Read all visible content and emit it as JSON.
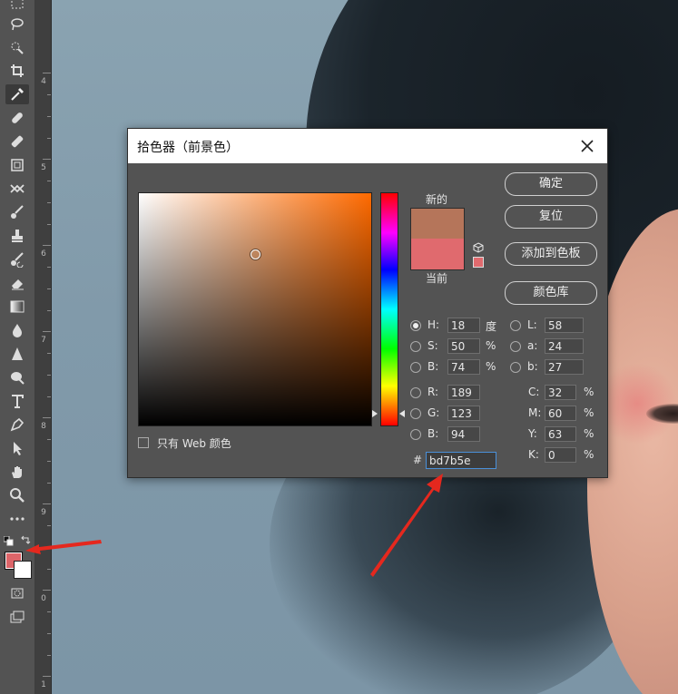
{
  "dialog": {
    "title": "拾色器（前景色）",
    "label_new": "新的",
    "label_current": "当前",
    "buttons": {
      "ok": "确定",
      "reset": "复位",
      "add_to_swatches": "添加到色板",
      "color_libraries": "颜色库"
    },
    "only_web_colors": "只有 Web 颜色",
    "hsb": {
      "h_label": "H:",
      "h": "18",
      "h_unit": "度",
      "s_label": "S:",
      "s": "50",
      "s_unit": "%",
      "b_label": "B:",
      "b": "74",
      "b_unit": "%"
    },
    "rgb": {
      "r_label": "R:",
      "r": "189",
      "g_label": "G:",
      "g": "123",
      "b_label": "B:",
      "b": "94"
    },
    "lab": {
      "l_label": "L:",
      "l": "58",
      "a_label": "a:",
      "a": "24",
      "b_label": "b:",
      "b": "27"
    },
    "cmyk": {
      "c_label": "C:",
      "c": "32",
      "c_unit": "%",
      "m_label": "M:",
      "m": "60",
      "m_unit": "%",
      "y_label": "Y:",
      "y": "63",
      "y_unit": "%",
      "k_label": "K:",
      "k": "0",
      "k_unit": "%"
    },
    "hex_label": "#",
    "hex": "bd7b5e",
    "colors": {
      "new": "#b5755a",
      "current": "#e06a6e",
      "hue_base": "#ff6a00"
    },
    "selected_mode": "H",
    "sv_position": {
      "saturation": 0.5,
      "brightness": 0.74
    },
    "hue_value_fraction": 0.95
  },
  "toolbar": {
    "foreground_color": "#dd6569",
    "background_color": "#ffffff",
    "tools": [
      "marquee-tool",
      "lasso-tool",
      "quick-select-tool",
      "crop-tool",
      "eyedropper-tool",
      "healing-brush-tool",
      "patch-tool",
      "frame-tool",
      "content-aware-move-tool",
      "brush-tool",
      "clone-stamp-tool",
      "history-brush-tool",
      "eraser-tool",
      "gradient-tool",
      "blur-tool",
      "sharpen-tool",
      "dodge-tool",
      "type-tool",
      "pen-tool",
      "path-select-tool",
      "hand-tool",
      "zoom-tool",
      "more-tools"
    ]
  },
  "ruler": {
    "labels": [
      "4",
      "5",
      "6",
      "7",
      "8",
      "9",
      "0",
      "1"
    ]
  }
}
